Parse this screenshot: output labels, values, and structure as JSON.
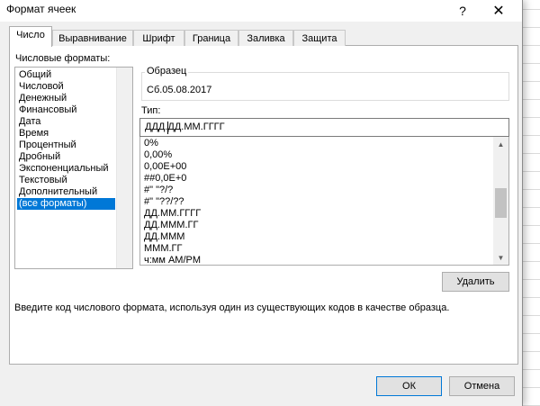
{
  "window": {
    "title": "Формат ячеек",
    "help": "?",
    "close": "✕"
  },
  "tabs": [
    {
      "label": "Число"
    },
    {
      "label": "Выравнивание"
    },
    {
      "label": "Шрифт"
    },
    {
      "label": "Граница"
    },
    {
      "label": "Заливка"
    },
    {
      "label": "Защита"
    }
  ],
  "active_tab": "Число",
  "categories": {
    "label": "Числовые форматы:",
    "items": [
      "Общий",
      "Числовой",
      "Денежный",
      "Финансовый",
      "Дата",
      "Время",
      "Процентный",
      "Дробный",
      "Экспоненциальный",
      "Текстовый",
      "Дополнительный",
      "(все форматы)"
    ],
    "selected": "(все форматы)"
  },
  "sample": {
    "label": "Образец",
    "value": "Сб.05.08.2017"
  },
  "type": {
    "label": "Тип:",
    "value": "ДДД.ДД.ММ.ГГГГ"
  },
  "format_codes": [
    "0%",
    "0,00%",
    "0,00E+00",
    "##0,0E+0",
    "#\" \"?/?",
    "#\" \"??/??",
    "ДД.ММ.ГГГГ",
    "ДД.МММ.ГГ",
    "ДД.МММ",
    "МММ.ГГ",
    "ч:мм AM/PM"
  ],
  "buttons": {
    "delete": "Удалить",
    "ok": "ОК",
    "cancel": "Отмена"
  },
  "hint": "Введите код числового формата, используя один из существующих кодов в качестве образца.",
  "colors": {
    "selection": "#0078d7",
    "dialog_bg": "#f0f0f0"
  }
}
